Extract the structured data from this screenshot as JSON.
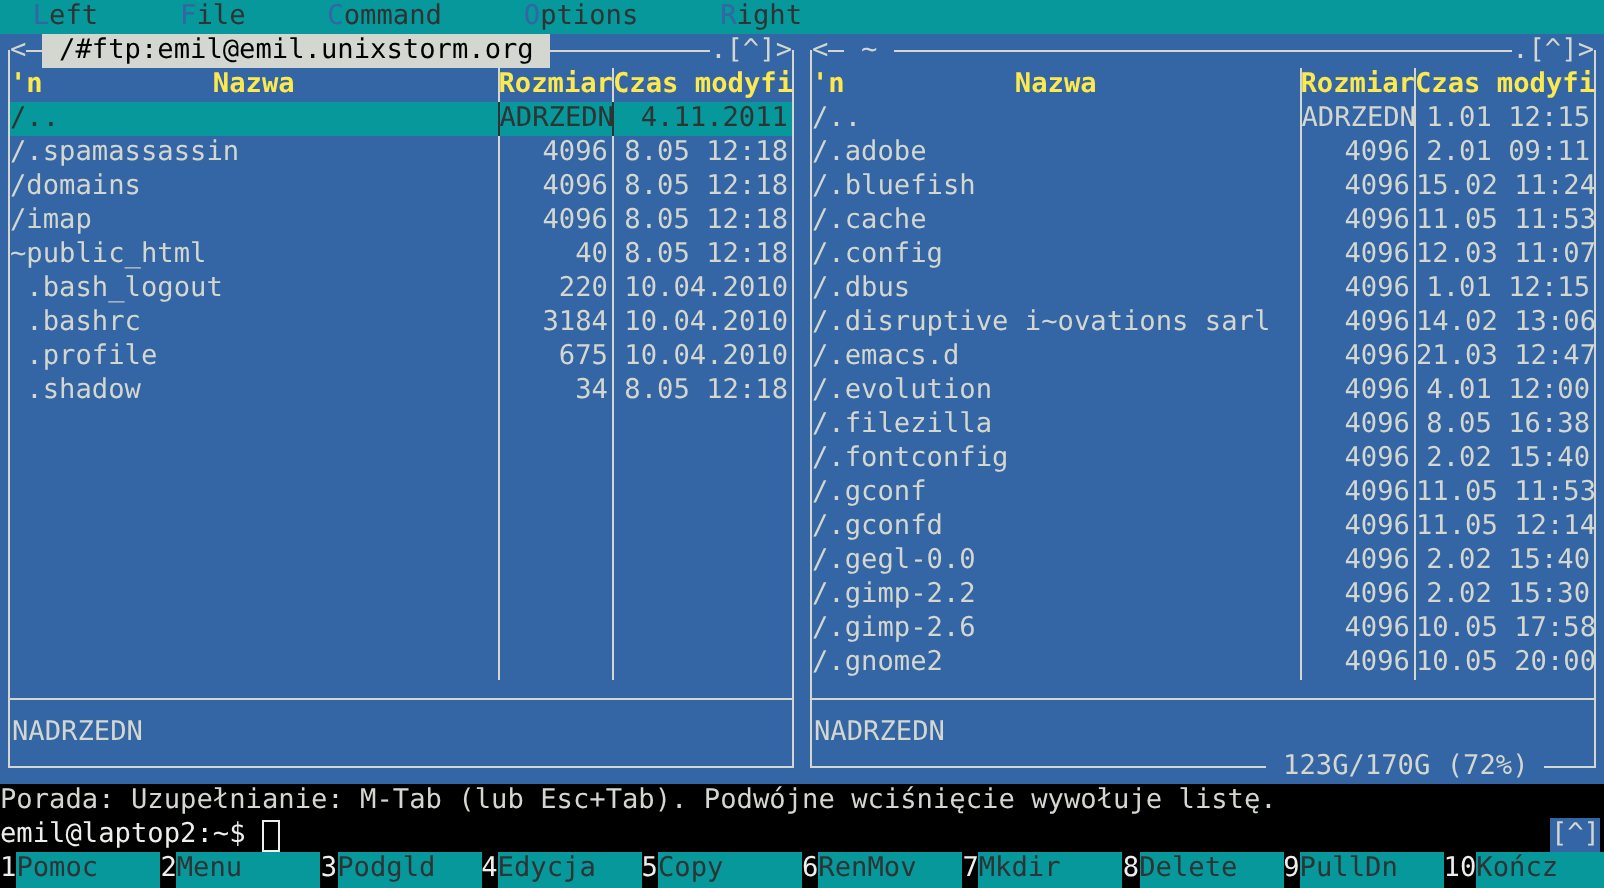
{
  "menu": [
    {
      "hotkey": "L",
      "rest": "eft"
    },
    {
      "hotkey": "F",
      "rest": "ile"
    },
    {
      "hotkey": "C",
      "rest": "ommand"
    },
    {
      "hotkey": "O",
      "rest": "ptions"
    },
    {
      "hotkey": "R",
      "rest": "ight"
    }
  ],
  "panels": [
    {
      "prev": "<",
      "title": "/#ftp:emil@emil.unixstorm.org",
      "active": true,
      "hidden_toggle": ".",
      "history": "[^]",
      "next": ">",
      "columns": {
        "sort": "'n",
        "name": "Nazwa",
        "size": "Rozmiar",
        "time": "Czas modyfi"
      },
      "rows": [
        {
          "name": "/..",
          "size": "ADRZEDN",
          "time": "4.11.2011",
          "selected": true
        },
        {
          "name": "/.spamassassin",
          "size": "4096",
          "time": "8.05 12:18",
          "selected": false
        },
        {
          "name": "/domains",
          "size": "4096",
          "time": "8.05 12:18",
          "selected": false
        },
        {
          "name": "/imap",
          "size": "4096",
          "time": "8.05 12:18",
          "selected": false
        },
        {
          "name": "~public_html",
          "size": "40",
          "time": "8.05 12:18",
          "selected": false
        },
        {
          "name": " .bash_logout",
          "size": "220",
          "time": "10.04.2010",
          "selected": false
        },
        {
          "name": " .bashrc",
          "size": "3184",
          "time": "10.04.2010",
          "selected": false
        },
        {
          "name": " .profile",
          "size": "675",
          "time": "10.04.2010",
          "selected": false
        },
        {
          "name": " .shadow",
          "size": "34",
          "time": "8.05 12:18",
          "selected": false
        }
      ],
      "mini_status": "NADRZEDN"
    },
    {
      "prev": "<",
      "title": "~",
      "active": false,
      "hidden_toggle": ".",
      "history": "[^]",
      "next": ">",
      "columns": {
        "sort": "'n",
        "name": "Nazwa",
        "size": "Rozmiar",
        "time": "Czas modyfi"
      },
      "rows": [
        {
          "name": "/..",
          "size": "ADRZEDN",
          "time": "1.01 12:15",
          "selected": false
        },
        {
          "name": "/.adobe",
          "size": "4096",
          "time": "2.01 09:11",
          "selected": false
        },
        {
          "name": "/.bluefish",
          "size": "4096",
          "time": "15.02 11:24",
          "selected": false
        },
        {
          "name": "/.cache",
          "size": "4096",
          "time": "11.05 11:53",
          "selected": false
        },
        {
          "name": "/.config",
          "size": "4096",
          "time": "12.03 11:07",
          "selected": false
        },
        {
          "name": "/.dbus",
          "size": "4096",
          "time": "1.01 12:15",
          "selected": false
        },
        {
          "name": "/.disruptive i~ovations sarl",
          "size": "4096",
          "time": "14.02 13:06",
          "selected": false
        },
        {
          "name": "/.emacs.d",
          "size": "4096",
          "time": "21.03 12:47",
          "selected": false
        },
        {
          "name": "/.evolution",
          "size": "4096",
          "time": "4.01 12:00",
          "selected": false
        },
        {
          "name": "/.filezilla",
          "size": "4096",
          "time": "8.05 16:38",
          "selected": false
        },
        {
          "name": "/.fontconfig",
          "size": "4096",
          "time": "2.02 15:40",
          "selected": false
        },
        {
          "name": "/.gconf",
          "size": "4096",
          "time": "11.05 11:53",
          "selected": false
        },
        {
          "name": "/.gconfd",
          "size": "4096",
          "time": "11.05 12:14",
          "selected": false
        },
        {
          "name": "/.gegl-0.0",
          "size": "4096",
          "time": "2.02 15:40",
          "selected": false
        },
        {
          "name": "/.gimp-2.2",
          "size": "4096",
          "time": "2.02 15:30",
          "selected": false
        },
        {
          "name": "/.gimp-2.6",
          "size": "4096",
          "time": "10.05 17:58",
          "selected": false
        },
        {
          "name": "/.gnome2",
          "size": "4096",
          "time": "10.05 20:00",
          "selected": false
        }
      ],
      "mini_status": "NADRZEDN",
      "disk_usage": "123G/170G (72%)"
    }
  ],
  "hint": "Porada: Uzupełnianie: M-Tab (lub Esc+Tab). Podwójne wciśnięcie wywołuje listę.",
  "prompt": {
    "text": "emil@laptop2:~$",
    "history": "[^]"
  },
  "function_keys": [
    {
      "number": "1",
      "label": "Pomoc"
    },
    {
      "number": "2",
      "label": "Menu"
    },
    {
      "number": "3",
      "label": "Podgld"
    },
    {
      "number": "4",
      "label": "Edycja"
    },
    {
      "number": "5",
      "label": "Copy"
    },
    {
      "number": "6",
      "label": "RenMov"
    },
    {
      "number": "7",
      "label": "Mkdir"
    },
    {
      "number": "8",
      "label": "Delete"
    },
    {
      "number": "9",
      "label": "PullDn"
    },
    {
      "number": "10",
      "label": "Kończ"
    }
  ]
}
